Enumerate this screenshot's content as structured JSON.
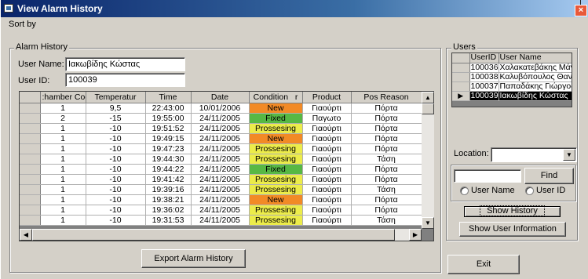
{
  "window": {
    "title": "View Alarm History",
    "close_glyph": "×"
  },
  "menu": {
    "sort_by": "Sort by"
  },
  "alarm_history": {
    "group_label": "Alarm History",
    "user_name_label": "User Name:",
    "user_name_value": "Ιακωβίδης Κώστας",
    "user_id_label": "User ID:",
    "user_id_value": "100039",
    "columns": [
      ":hamber Cod",
      "Temperatur",
      "Time",
      "Date",
      "Condition",
      "Product",
      "Pos Reason"
    ],
    "sort_glyph": "r",
    "rows": [
      {
        "chamber": "1",
        "temp": "9,5",
        "time": "22:43:00",
        "date": "10/01/2006",
        "condition": "New",
        "product": "Γιαούρτι",
        "reason": "Πόρτα"
      },
      {
        "chamber": "2",
        "temp": "-15",
        "time": "19:55:00",
        "date": "24/11/2005",
        "condition": "Fixed",
        "product": "Παγωτο",
        "reason": "Πόρτα"
      },
      {
        "chamber": "1",
        "temp": "-10",
        "time": "19:51:52",
        "date": "24/11/2005",
        "condition": "Prossesing",
        "product": "Γιαούρτι",
        "reason": "Πόρτα"
      },
      {
        "chamber": "1",
        "temp": "-10",
        "time": "19:49:15",
        "date": "24/11/2005",
        "condition": "New",
        "product": "Γιαούρτι",
        "reason": "Πόρτα"
      },
      {
        "chamber": "1",
        "temp": "-10",
        "time": "19:47:23",
        "date": "24/11/2005",
        "condition": "Prossesing",
        "product": "Γιαούρτι",
        "reason": "Πόρτα"
      },
      {
        "chamber": "1",
        "temp": "-10",
        "time": "19:44:30",
        "date": "24/11/2005",
        "condition": "Prossesing",
        "product": "Γιαούρτι",
        "reason": "Τάση"
      },
      {
        "chamber": "1",
        "temp": "-10",
        "time": "19:44:22",
        "date": "24/11/2005",
        "condition": "Fixed",
        "product": "Γιαούρτι",
        "reason": "Πόρτα"
      },
      {
        "chamber": "1",
        "temp": "-10",
        "time": "19:41:42",
        "date": "24/11/2005",
        "condition": "Prossesing",
        "product": "Γιαούρτι",
        "reason": "Πόρτα"
      },
      {
        "chamber": "1",
        "temp": "-10",
        "time": "19:39:16",
        "date": "24/11/2005",
        "condition": "Prossesing",
        "product": "Γιαούρτι",
        "reason": "Τάση"
      },
      {
        "chamber": "1",
        "temp": "-10",
        "time": "19:38:21",
        "date": "24/11/2005",
        "condition": "New",
        "product": "Γιαούρτι",
        "reason": "Πόρτα"
      },
      {
        "chamber": "1",
        "temp": "-10",
        "time": "19:36:02",
        "date": "24/11/2005",
        "condition": "Prossesing",
        "product": "Γιαούρτι",
        "reason": "Πόρτα"
      },
      {
        "chamber": "1",
        "temp": "-10",
        "time": "19:31:53",
        "date": "24/11/2005",
        "condition": "Prossesing",
        "product": "Γιαούρτι",
        "reason": "Τάση"
      }
    ],
    "condition_colors": {
      "New": "#f28a26",
      "Fixed": "#57b844",
      "Prossesing": "#ecec4a"
    },
    "export_button": "Export Alarm History"
  },
  "users": {
    "group_label": "Users",
    "columns": [
      "UserID",
      "User Name"
    ],
    "rows": [
      {
        "id": "100036",
        "name": "Χαλακατεβάκης Μάνο"
      },
      {
        "id": "100038",
        "name": "Καλυβόπουλος Θανάσι"
      },
      {
        "id": "100037",
        "name": "Παπαδάκης Γιώργος"
      },
      {
        "id": "100039",
        "name": "Ιακωβίδης Κώστας",
        "selected": true
      }
    ],
    "selected_marker": "▶",
    "location_label": "Location:",
    "location_value": "",
    "find_value": "",
    "find_button": "Find",
    "radio_user_name": "User Name",
    "radio_user_id": "User ID",
    "show_history_button": "Show History",
    "show_info_button": "Show User Information"
  },
  "exit_button": "Exit"
}
